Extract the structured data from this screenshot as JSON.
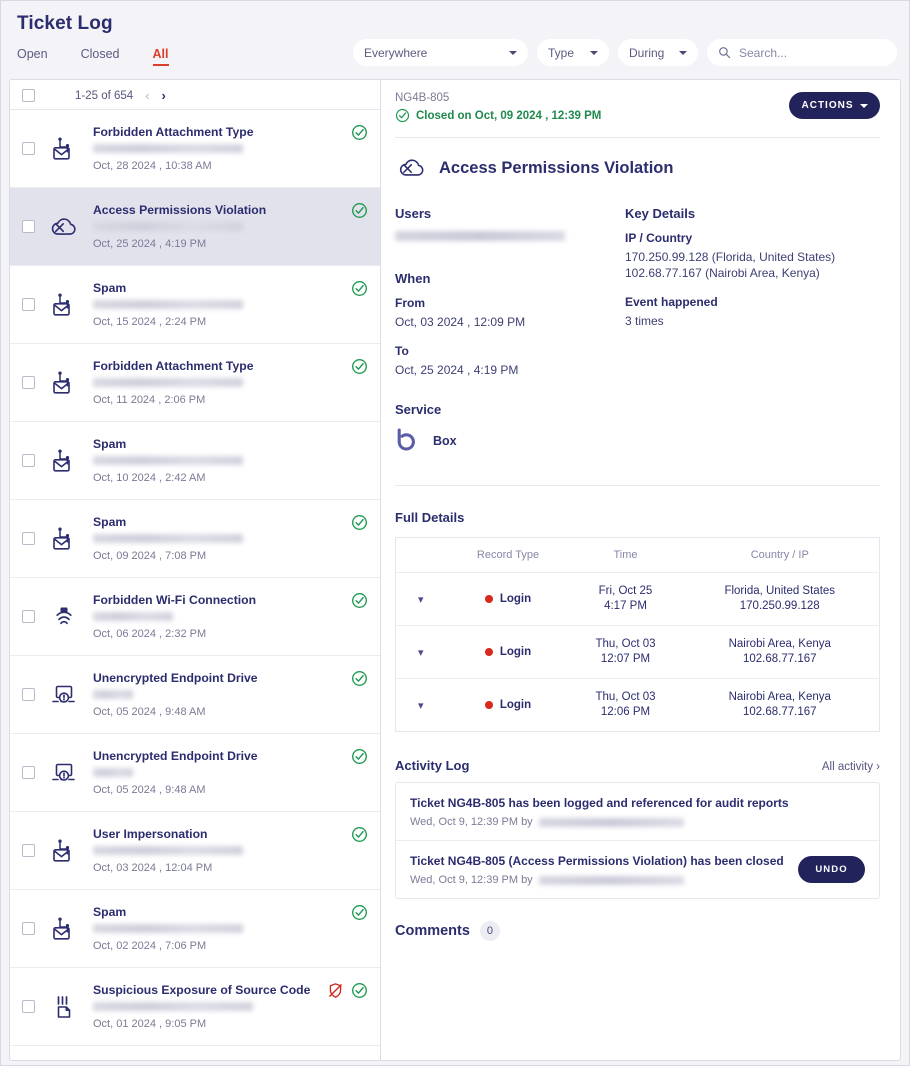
{
  "header": {
    "title": "Ticket Log",
    "tabs": [
      {
        "label": "Open",
        "active": false
      },
      {
        "label": "Closed",
        "active": false
      },
      {
        "label": "All",
        "active": true
      }
    ],
    "filters": {
      "scope": "Everywhere",
      "type": "Type",
      "during": "During",
      "search_placeholder": "Search..."
    },
    "accent_red": "#d8402a",
    "navy": "#2b2d6e"
  },
  "list": {
    "pagination": {
      "range": "1-25 of 654",
      "prev": "‹",
      "next": "›"
    },
    "items": [
      {
        "title": "Forbidden Attachment Type",
        "date": "Oct, 28 2024 , 10:38 AM",
        "icon": "mail-alert-icon",
        "closed": true,
        "blocked": false,
        "selected": false
      },
      {
        "title": "Access Permissions Violation",
        "date": "Oct, 25 2024 , 4:19 PM",
        "icon": "cloud-denied-icon",
        "closed": true,
        "blocked": false,
        "selected": true
      },
      {
        "title": "Spam",
        "date": "Oct, 15 2024 , 2:24 PM",
        "icon": "mail-alert-icon",
        "closed": true,
        "blocked": false,
        "selected": false
      },
      {
        "title": "Forbidden Attachment Type",
        "date": "Oct, 11 2024 , 2:06 PM",
        "icon": "mail-alert-icon",
        "closed": true,
        "blocked": false,
        "selected": false
      },
      {
        "title": "Spam",
        "date": "Oct, 10 2024 , 2:42 AM",
        "icon": "mail-alert-icon",
        "closed": false,
        "blocked": false,
        "selected": false
      },
      {
        "title": "Spam",
        "date": "Oct, 09 2024 , 7:08 PM",
        "icon": "mail-alert-icon",
        "closed": true,
        "blocked": false,
        "selected": false
      },
      {
        "title": "Forbidden Wi-Fi Connection",
        "date": "Oct, 06 2024 , 2:32 PM",
        "icon": "wifi-icon",
        "closed": true,
        "blocked": false,
        "selected": false
      },
      {
        "title": "Unencrypted Endpoint Drive",
        "date": "Oct, 05 2024 , 9:48 AM",
        "icon": "monitor-alert-icon",
        "closed": true,
        "blocked": false,
        "selected": false
      },
      {
        "title": "Unencrypted Endpoint Drive",
        "date": "Oct, 05 2024 , 9:48 AM",
        "icon": "monitor-alert-icon",
        "closed": true,
        "blocked": false,
        "selected": false
      },
      {
        "title": "User Impersonation",
        "date": "Oct, 03 2024 , 12:04 PM",
        "icon": "mail-alert-icon",
        "closed": true,
        "blocked": false,
        "selected": false
      },
      {
        "title": "Spam",
        "date": "Oct, 02 2024 , 7:06 PM",
        "icon": "mail-alert-icon",
        "closed": true,
        "blocked": false,
        "selected": false
      },
      {
        "title": "Suspicious Exposure of Source Code",
        "date": "Oct, 01 2024 , 9:05 PM",
        "icon": "source-code-icon",
        "closed": true,
        "blocked": true,
        "selected": false
      }
    ]
  },
  "detail": {
    "ticket_id": "NG4B-805",
    "closed_on": "Closed on Oct, 09 2024 , 12:39 PM",
    "actions_label": "ACTIONS",
    "title": "Access Permissions Violation",
    "users_label": "Users",
    "when_label": "When",
    "from_label": "From",
    "from_value": "Oct, 03 2024 , 12:09 PM",
    "to_label": "To",
    "to_value": "Oct, 25 2024 , 4:19 PM",
    "key_details_label": "Key Details",
    "ip_country_label": "IP / Country",
    "ip_country_value": "170.250.99.128 (Florida, United States)\n102.68.77.167 (Nairobi Area, Kenya)",
    "event_happened_label": "Event happened",
    "event_happened_value": "3 times",
    "service_label": "Service",
    "service_name": "Box",
    "full_details_label": "Full Details",
    "table": {
      "columns": [
        "",
        "Record Type",
        "Time",
        "Country / IP"
      ],
      "rows": [
        {
          "record_type": "Login",
          "time_day": "Fri, Oct 25",
          "time_clock": "4:17 PM",
          "country": "Florida, United States",
          "ip": "170.250.99.128"
        },
        {
          "record_type": "Login",
          "time_day": "Thu, Oct 03",
          "time_clock": "12:07 PM",
          "country": "Nairobi Area, Kenya",
          "ip": "102.68.77.167"
        },
        {
          "record_type": "Login",
          "time_day": "Thu, Oct 03",
          "time_clock": "12:06 PM",
          "country": "Nairobi Area, Kenya",
          "ip": "102.68.77.167"
        }
      ]
    },
    "activity_log_label": "Activity Log",
    "all_activity_label": "All activity ›",
    "activity": [
      {
        "text": "Ticket NG4B-805 has been logged and referenced for audit reports",
        "meta": "Wed, Oct 9, 12:39 PM by",
        "undo": false
      },
      {
        "text": "Ticket NG4B-805 (Access Permissions Violation) has been closed",
        "meta": "Wed, Oct 9, 12:39 PM by",
        "undo": true
      }
    ],
    "undo_label": "UNDO",
    "comments_label": "Comments",
    "comments_count": "0"
  }
}
